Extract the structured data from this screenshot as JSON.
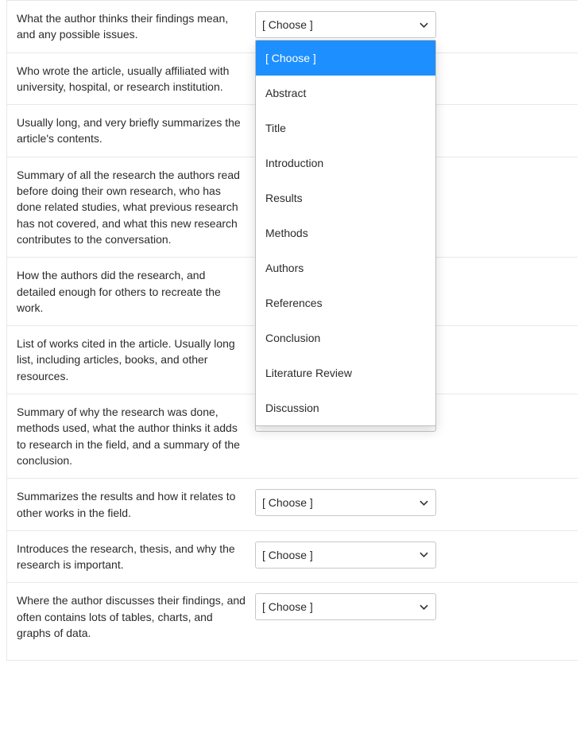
{
  "select_placeholder": "[ Choose ]",
  "rows": [
    {
      "prompt": "What the author thinks their findings mean, and any possible issues."
    },
    {
      "prompt": "Who wrote the article, usually affiliated with university, hospital, or research institution."
    },
    {
      "prompt": "Usually long, and very briefly summarizes the article's contents."
    },
    {
      "prompt": "Summary of all the research the authors read before doing their own research, who has done related studies, what previous research has not covered, and what this new research contributes to the conversation."
    },
    {
      "prompt": "How the authors did the research, and detailed enough for others to recreate the work."
    },
    {
      "prompt": "List of works cited in the article. Usually long list, including articles, books, and other resources."
    },
    {
      "prompt": "Summary of why the research was done, methods used, what the author thinks it adds to research in the field, and a summary of the conclusion."
    },
    {
      "prompt": "Summarizes the results and how it relates to other works in the field."
    },
    {
      "prompt": "Introduces the research, thesis, and why the research is important."
    },
    {
      "prompt": "Where the author discusses their findings, and often contains lots of tables, charts, and graphs of data."
    }
  ],
  "dropdown": {
    "open_on_row": 0,
    "highlighted_index": 0,
    "options": [
      "[ Choose ]",
      "Abstract",
      "Title",
      "Introduction",
      "Results",
      "Methods",
      "Authors",
      "References",
      "Conclusion",
      "Literature Review",
      "Discussion"
    ]
  }
}
